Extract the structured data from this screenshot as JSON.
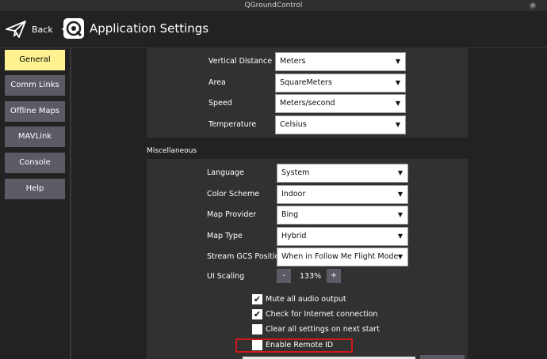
{
  "window": {
    "title": "QGroundControl",
    "close_glyph": "×"
  },
  "toolbar": {
    "back_label": "Back",
    "back_chevron": "<",
    "page_title": "Application Settings",
    "icons": {
      "plan": "paper-plane-icon",
      "logo": "qgc-logo-icon"
    }
  },
  "sidebar": {
    "items": [
      {
        "label": "General",
        "active": true
      },
      {
        "label": "Comm Links",
        "active": false
      },
      {
        "label": "Offline Maps",
        "active": false
      },
      {
        "label": "MAVLink",
        "active": false
      },
      {
        "label": "Console",
        "active": false
      },
      {
        "label": "Help",
        "active": false
      }
    ]
  },
  "units": {
    "rows": [
      {
        "label": "Vertical Distance",
        "value": "Meters"
      },
      {
        "label": "Area",
        "value": "SquareMeters"
      },
      {
        "label": "Speed",
        "value": "Meters/second"
      },
      {
        "label": "Temperature",
        "value": "Celsius"
      }
    ]
  },
  "misc": {
    "section_title": "Miscellaneous",
    "rows": [
      {
        "label": "Language",
        "value": "System"
      },
      {
        "label": "Color Scheme",
        "value": "Indoor"
      },
      {
        "label": "Map Provider",
        "value": "Bing"
      },
      {
        "label": "Map Type",
        "value": "Hybrid"
      },
      {
        "label": "Stream GCS Position",
        "value": "When in Follow Me Flight Mode"
      }
    ],
    "ui_scaling": {
      "label": "UI Scaling",
      "minus": "-",
      "value": "133%",
      "plus": "+"
    },
    "checks": [
      {
        "label": "Mute all audio output",
        "checked": true
      },
      {
        "label": "Check for Internet connection",
        "checked": true
      },
      {
        "label": "Clear all settings on next start",
        "checked": false
      },
      {
        "label": "Enable Remote ID",
        "checked": false
      }
    ],
    "check_glyph": "✔",
    "dropdown_arrow": "▼"
  },
  "colors": {
    "accent": "#fff291",
    "button": "#5b5b66",
    "panel": "#313131",
    "highlight": "#d11a1a"
  }
}
